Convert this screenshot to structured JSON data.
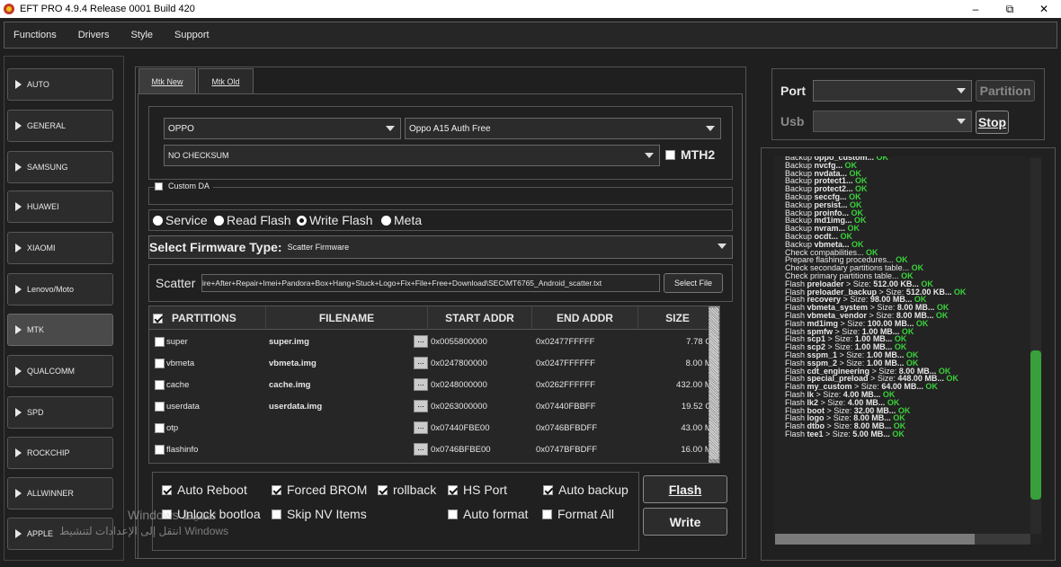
{
  "window": {
    "title": "EFT PRO 4.9.4 Release 0001 Build 420",
    "min": "–",
    "max": "⧉",
    "close": "✕"
  },
  "menu": [
    "Functions",
    "Drivers",
    "Style",
    "Support"
  ],
  "sidebar": [
    "AUTO",
    "GENERAL",
    "SAMSUNG",
    "HUAWEI",
    "XIAOMI",
    "Lenovo/Moto",
    "MTK",
    "QUALCOMM",
    "SPD",
    "ROCKCHIP",
    "ALLWINNER",
    "APPLE"
  ],
  "tabs": [
    "Mtk New",
    "Mtk Old"
  ],
  "brand": "OPPO",
  "model": "Oppo A15 Auth Free",
  "checksum": "NO CHECKSUM",
  "mth2": "MTH2",
  "custom_da": "Custom DA",
  "modes": [
    "Service",
    "Read Flash",
    "Write Flash",
    "Meta"
  ],
  "firmware_type_label": "Select Firmware Type:",
  "firmware_type": "Scatter Firmware",
  "scatter_label": "Scatter",
  "scatter_path": "ire+After+Repair+Imei+Pandora+Box+Hang+Stuck+Logo+Fix+File+Free+Download\\SEC\\MT6765_Android_scatter.txt",
  "select_file": "Select File",
  "table_headers": [
    "PARTITIONS",
    "FILENAME",
    "START ADDR",
    "END ADDR",
    "SIZE"
  ],
  "partitions": [
    {
      "name": "super",
      "file": "super.img",
      "start": "0x0055800000",
      "end": "0x02477FFFFF",
      "size": "7.78 GB"
    },
    {
      "name": "vbmeta",
      "file": "vbmeta.img",
      "start": "0x0247800000",
      "end": "0x0247FFFFFF",
      "size": "8.00 MB"
    },
    {
      "name": "cache",
      "file": "cache.img",
      "start": "0x0248000000",
      "end": "0x0262FFFFFF",
      "size": "432.00 MB"
    },
    {
      "name": "userdata",
      "file": "userdata.img",
      "start": "0x0263000000",
      "end": "0x07440FBBFF",
      "size": "19.52 GB"
    },
    {
      "name": "otp",
      "file": "",
      "start": "0x07440FBE00",
      "end": "0x0746BFBDFF",
      "size": "43.00 MB"
    },
    {
      "name": "flashinfo",
      "file": "",
      "start": "0x0746BFBE00",
      "end": "0x0747BFBDFF",
      "size": "16.00 MB"
    }
  ],
  "options": {
    "auto_reboot": "Auto Reboot",
    "forced_brom": "Forced BROM",
    "rollback": "rollback",
    "hs_port": "HS Port",
    "auto_backup": "Auto backup",
    "unlock_bootloader": "Unlock bootloa",
    "skip_nv": "Skip NV Items",
    "auto_format": "Auto format",
    "format_all": "Format All"
  },
  "flash_btn": "Flash",
  "write_btn": "Write",
  "watermark": {
    "line1": "Windows ‎‏تنشيط",
    "line2": "انتقل إلى الإعدادات لتنشيط Windows"
  },
  "right": {
    "port": "Port",
    "usb": "Usb",
    "partition": "Partition",
    "stop": "Stop"
  },
  "log": [
    {
      "t": "Backup ",
      "b": "oppo_custom...",
      "ok": " OK"
    },
    {
      "t": "Backup ",
      "b": "nvcfg...",
      "ok": " OK"
    },
    {
      "t": "Backup ",
      "b": "nvdata...",
      "ok": " OK"
    },
    {
      "t": "Backup ",
      "b": "protect1...",
      "ok": " OK"
    },
    {
      "t": "Backup ",
      "b": "protect2...",
      "ok": " OK"
    },
    {
      "t": "Backup ",
      "b": "seccfg...",
      "ok": " OK"
    },
    {
      "t": "Backup ",
      "b": "persist...",
      "ok": " OK"
    },
    {
      "t": "Backup ",
      "b": "proinfo...",
      "ok": " OK"
    },
    {
      "t": "Backup ",
      "b": "md1img...",
      "ok": " OK"
    },
    {
      "t": "Backup ",
      "b": "nvram...",
      "ok": " OK"
    },
    {
      "t": "Backup ",
      "b": "ocdt...",
      "ok": " OK"
    },
    {
      "t": "Backup ",
      "b": "vbmeta...",
      "ok": " OK"
    },
    {
      "t": "Check compabilities...",
      "b": "",
      "ok": " OK"
    },
    {
      "t": "Prepare flashing procedures...",
      "b": "",
      "ok": " OK"
    },
    {
      "t": "Check secondary partitions table...",
      "b": "",
      "ok": " OK"
    },
    {
      "t": "Check primary partitions table...",
      "b": "",
      "ok": " OK"
    },
    {
      "t": "Flash ",
      "b": "preloader",
      "s": " > Size: ",
      "sz": "512.00 KB...",
      "ok": " OK"
    },
    {
      "t": "Flash ",
      "b": "preloader_backup",
      "s": " > Size: ",
      "sz": "512.00 KB...",
      "ok": " OK"
    },
    {
      "t": "Flash ",
      "b": "recovery",
      "s": " > Size: ",
      "sz": "98.00 MB...",
      "ok": " OK"
    },
    {
      "t": "Flash ",
      "b": "vbmeta_system",
      "s": " > Size: ",
      "sz": "8.00 MB...",
      "ok": " OK"
    },
    {
      "t": "Flash ",
      "b": "vbmeta_vendor",
      "s": " > Size: ",
      "sz": "8.00 MB...",
      "ok": " OK"
    },
    {
      "t": "Flash ",
      "b": "md1img",
      "s": " > Size: ",
      "sz": "100.00 MB...",
      "ok": " OK"
    },
    {
      "t": "Flash ",
      "b": "spmfw",
      "s": " > Size: ",
      "sz": "1.00 MB...",
      "ok": " OK"
    },
    {
      "t": "Flash ",
      "b": "scp1",
      "s": " > Size: ",
      "sz": "1.00 MB...",
      "ok": " OK"
    },
    {
      "t": "Flash ",
      "b": "scp2",
      "s": " > Size: ",
      "sz": "1.00 MB...",
      "ok": " OK"
    },
    {
      "t": "Flash ",
      "b": "sspm_1",
      "s": " > Size: ",
      "sz": "1.00 MB...",
      "ok": " OK"
    },
    {
      "t": "Flash ",
      "b": "sspm_2",
      "s": " > Size: ",
      "sz": "1.00 MB...",
      "ok": " OK"
    },
    {
      "t": "Flash ",
      "b": "cdt_engineering",
      "s": " > Size: ",
      "sz": "8.00 MB...",
      "ok": " OK"
    },
    {
      "t": "Flash ",
      "b": "special_preload",
      "s": " > Size: ",
      "sz": "448.00 MB...",
      "ok": " OK"
    },
    {
      "t": "Flash ",
      "b": "my_custom",
      "s": " > Size: ",
      "sz": "64.00 MB...",
      "ok": " OK"
    },
    {
      "t": "Flash ",
      "b": "lk",
      "s": " > Size: ",
      "sz": "4.00 MB...",
      "ok": " OK"
    },
    {
      "t": "Flash ",
      "b": "lk2",
      "s": " > Size: ",
      "sz": "4.00 MB...",
      "ok": " OK"
    },
    {
      "t": "Flash ",
      "b": "boot",
      "s": " > Size: ",
      "sz": "32.00 MB...",
      "ok": " OK"
    },
    {
      "t": "Flash ",
      "b": "logo",
      "s": " > Size: ",
      "sz": "8.00 MB...",
      "ok": " OK"
    },
    {
      "t": "Flash ",
      "b": "dtbo",
      "s": " > Size: ",
      "sz": "8.00 MB...",
      "ok": " OK"
    },
    {
      "t": "Flash ",
      "b": "tee1",
      "s": " > Size: ",
      "sz": "5.00 MB...",
      "ok": " OK"
    }
  ]
}
